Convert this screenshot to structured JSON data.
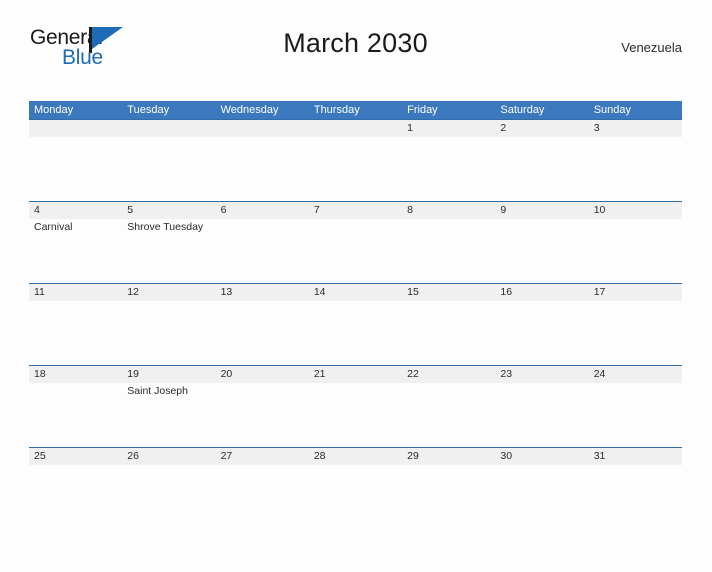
{
  "brand": {
    "name_dark": "General",
    "name_blue": "Blue",
    "flag_icon": "flag-triangle-icon",
    "accent_color": "#1f6bb5"
  },
  "header": {
    "title": "March 2030",
    "region": "Venezuela"
  },
  "colors": {
    "weekday_header_bg": "#3b78bd",
    "weekday_header_text": "#ffffff",
    "daynum_band_bg": "#f0f0f0",
    "row_divider": "#2f6ca8",
    "page_bg": "#fdfdfd",
    "text": "#2b2b2b"
  },
  "calendar": {
    "weekdays": [
      "Monday",
      "Tuesday",
      "Wednesday",
      "Thursday",
      "Friday",
      "Saturday",
      "Sunday"
    ],
    "weeks": [
      [
        {
          "day": "",
          "event": ""
        },
        {
          "day": "",
          "event": ""
        },
        {
          "day": "",
          "event": ""
        },
        {
          "day": "",
          "event": ""
        },
        {
          "day": "1",
          "event": ""
        },
        {
          "day": "2",
          "event": ""
        },
        {
          "day": "3",
          "event": ""
        }
      ],
      [
        {
          "day": "4",
          "event": "Carnival"
        },
        {
          "day": "5",
          "event": "Shrove Tuesday"
        },
        {
          "day": "6",
          "event": ""
        },
        {
          "day": "7",
          "event": ""
        },
        {
          "day": "8",
          "event": ""
        },
        {
          "day": "9",
          "event": ""
        },
        {
          "day": "10",
          "event": ""
        }
      ],
      [
        {
          "day": "11",
          "event": ""
        },
        {
          "day": "12",
          "event": ""
        },
        {
          "day": "13",
          "event": ""
        },
        {
          "day": "14",
          "event": ""
        },
        {
          "day": "15",
          "event": ""
        },
        {
          "day": "16",
          "event": ""
        },
        {
          "day": "17",
          "event": ""
        }
      ],
      [
        {
          "day": "18",
          "event": ""
        },
        {
          "day": "19",
          "event": "Saint Joseph"
        },
        {
          "day": "20",
          "event": ""
        },
        {
          "day": "21",
          "event": ""
        },
        {
          "day": "22",
          "event": ""
        },
        {
          "day": "23",
          "event": ""
        },
        {
          "day": "24",
          "event": ""
        }
      ],
      [
        {
          "day": "25",
          "event": ""
        },
        {
          "day": "26",
          "event": ""
        },
        {
          "day": "27",
          "event": ""
        },
        {
          "day": "28",
          "event": ""
        },
        {
          "day": "29",
          "event": ""
        },
        {
          "day": "30",
          "event": ""
        },
        {
          "day": "31",
          "event": ""
        }
      ]
    ]
  }
}
